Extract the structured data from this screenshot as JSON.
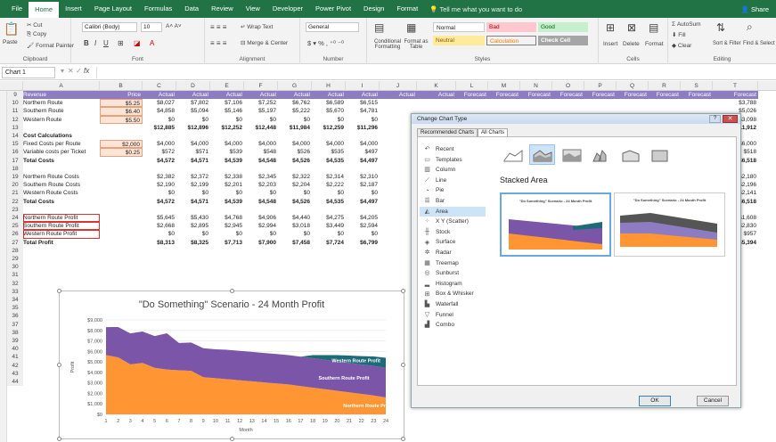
{
  "ribbon_tabs": [
    "File",
    "Home",
    "Insert",
    "Page Layout",
    "Formulas",
    "Data",
    "Review",
    "View",
    "Developer",
    "Power Pivot",
    "Design",
    "Format"
  ],
  "active_tab": "Home",
  "tell_me": "Tell me what you want to do",
  "share": "Share",
  "clipboard": {
    "paste": "Paste",
    "cut": "Cut",
    "copy": "Copy",
    "format_painter": "Format Painter",
    "label": "Clipboard"
  },
  "font": {
    "name": "Calibri (Body)",
    "size": "10",
    "label": "Font"
  },
  "alignment": {
    "wrap": "Wrap Text",
    "merge": "Merge & Center",
    "label": "Alignment"
  },
  "number": {
    "format": "General",
    "label": "Number"
  },
  "styles": {
    "cond": "Conditional Formatting",
    "table": "Format as Table",
    "normal": "Normal",
    "bad": "Bad",
    "good": "Good",
    "neutral": "Neutral",
    "calculation": "Calculation",
    "check": "Check Cell",
    "label": "Styles"
  },
  "cells": {
    "insert": "Insert",
    "delete": "Delete",
    "format": "Format",
    "label": "Cells"
  },
  "editing": {
    "autosum": "AutoSum",
    "fill": "Fill",
    "clear": "Clear",
    "sort": "Sort & Filter",
    "find": "Find & Select",
    "label": "Editing"
  },
  "namebox": "Chart 1",
  "fx": "fx",
  "columns": [
    "A",
    "B",
    "C",
    "D",
    "E",
    "F",
    "G",
    "H",
    "I",
    "J",
    "K",
    "L",
    "M",
    "N",
    "O",
    "P",
    "Q",
    "R",
    "S",
    "T"
  ],
  "header_row": {
    "num": "9",
    "a": "Revenue",
    "b": "Price",
    "cols": [
      "Actual",
      "Actual",
      "Actual",
      "Actual",
      "Actual",
      "Actual",
      "Actual",
      "Actual",
      "Actual"
    ],
    "forecast": [
      "Forecast",
      "Forecast",
      "Forecast",
      "Forecast",
      "Forecast",
      "Forecast",
      "Forecast",
      "Forecast",
      "Forecast",
      "Forecast"
    ]
  },
  "rows": [
    {
      "num": "10",
      "a": "Northern Route",
      "b": "$5.25",
      "vals": [
        "$8,027",
        "$7,802",
        "$7,106",
        "$7,252",
        "$6,762",
        "$6,589",
        "$6,515"
      ],
      "right": "$3,788"
    },
    {
      "num": "11",
      "a": "Southern Route",
      "b": "$6.40",
      "vals": [
        "$4,858",
        "$5,094",
        "$5,146",
        "$5,197",
        "$5,222",
        "$5,670",
        "$4,781"
      ],
      "right": "$5,026"
    },
    {
      "num": "12",
      "a": "Western Route",
      "b": "$5.50",
      "vals": [
        "$0",
        "$0",
        "$0",
        "$0",
        "$0",
        "$0",
        "$0"
      ],
      "right": "$3,098"
    },
    {
      "num": "13",
      "a": "",
      "b": "",
      "vals": [
        "$12,885",
        "$12,896",
        "$12,252",
        "$12,448",
        "$11,984",
        "$12,259",
        "$11,296"
      ],
      "right": "$11,912",
      "bold": true
    },
    {
      "num": "14",
      "a": "Cost Calculations",
      "b": "",
      "vals": [],
      "right": "",
      "bold": true
    },
    {
      "num": "15",
      "a": "Fixed Costs per Route",
      "b": "$2,000",
      "vals": [
        "$4,000",
        "$4,000",
        "$4,000",
        "$4,000",
        "$4,000",
        "$4,000",
        "$4,000"
      ],
      "right": "$6,000"
    },
    {
      "num": "16",
      "a": "Variable costs per Ticket",
      "b": "$0.25",
      "vals": [
        "$572",
        "$571",
        "$539",
        "$548",
        "$526",
        "$535",
        "$497"
      ],
      "right": "$518"
    },
    {
      "num": "17",
      "a": "Total Costs",
      "b": "",
      "vals": [
        "$4,572",
        "$4,571",
        "$4,539",
        "$4,548",
        "$4,526",
        "$4,535",
        "$4,497"
      ],
      "right": "$6,518",
      "bold": true
    },
    {
      "num": "18",
      "a": "",
      "b": "",
      "vals": [],
      "right": ""
    },
    {
      "num": "19",
      "a": "Northern Route Costs",
      "b": "",
      "vals": [
        "$2,382",
        "$2,372",
        "$2,338",
        "$2,345",
        "$2,322",
        "$2,314",
        "$2,310"
      ],
      "right": "$2,180"
    },
    {
      "num": "20",
      "a": "Southern Route Costs",
      "b": "",
      "vals": [
        "$2,190",
        "$2,199",
        "$2,201",
        "$2,203",
        "$2,204",
        "$2,222",
        "$2,187"
      ],
      "right": "$2,196"
    },
    {
      "num": "21",
      "a": "Western Route Costs",
      "b": "",
      "vals": [
        "$0",
        "$0",
        "$0",
        "$0",
        "$0",
        "$0",
        "$0"
      ],
      "right": "$2,141"
    },
    {
      "num": "22",
      "a": "Total Costs",
      "b": "",
      "vals": [
        "$4,572",
        "$4,571",
        "$4,539",
        "$4,548",
        "$4,526",
        "$4,535",
        "$4,497"
      ],
      "right": "$6,518",
      "bold": true
    },
    {
      "num": "23",
      "a": "",
      "b": "",
      "vals": [],
      "right": ""
    },
    {
      "num": "24",
      "a": "Northern Route Profit",
      "b": "",
      "vals": [
        "$5,645",
        "$5,430",
        "$4,768",
        "$4,906",
        "$4,440",
        "$4,275",
        "$4,205"
      ],
      "right": "$1,608"
    },
    {
      "num": "25",
      "a": "Southern Route Profit",
      "b": "",
      "vals": [
        "$2,668",
        "$2,895",
        "$2,945",
        "$2,994",
        "$3,018",
        "$3,449",
        "$2,594"
      ],
      "right": "$2,830"
    },
    {
      "num": "26",
      "a": "Western Route Profit",
      "b": "",
      "vals": [
        "$0",
        "$0",
        "$0",
        "$0",
        "$0",
        "$0",
        "$0"
      ],
      "right": "$957"
    },
    {
      "num": "27",
      "a": "Total Profit",
      "b": "",
      "vals": [
        "$8,313",
        "$8,325",
        "$7,713",
        "$7,900",
        "$7,458",
        "$7,724",
        "$6,799"
      ],
      "right": "$5,394",
      "bold": true
    }
  ],
  "empty_rows": [
    "28",
    "29",
    "30",
    "31",
    "32",
    "33",
    "34",
    "35",
    "36",
    "37",
    "38",
    "39",
    "40",
    "41",
    "42",
    "43",
    "44"
  ],
  "dialog": {
    "title": "Change Chart Type",
    "tabs": [
      "Recommended Charts",
      "All Charts"
    ],
    "types": [
      {
        "label": "Recent",
        "icon": "recent-icon",
        "glyph": "↶"
      },
      {
        "label": "Templates",
        "icon": "templates-icon",
        "glyph": "▭"
      },
      {
        "label": "Column",
        "icon": "column-chart-icon",
        "glyph": "▥"
      },
      {
        "label": "Line",
        "icon": "line-chart-icon",
        "glyph": "⟋"
      },
      {
        "label": "Pie",
        "icon": "pie-chart-icon",
        "glyph": "◔"
      },
      {
        "label": "Bar",
        "icon": "bar-chart-icon",
        "glyph": "☰"
      },
      {
        "label": "Area",
        "icon": "area-chart-icon",
        "glyph": "◭"
      },
      {
        "label": "X Y (Scatter)",
        "icon": "scatter-chart-icon",
        "glyph": "⁘"
      },
      {
        "label": "Stock",
        "icon": "stock-chart-icon",
        "glyph": "╫"
      },
      {
        "label": "Surface",
        "icon": "surface-chart-icon",
        "glyph": "◈"
      },
      {
        "label": "Radar",
        "icon": "radar-chart-icon",
        "glyph": "✲"
      },
      {
        "label": "Treemap",
        "icon": "treemap-icon",
        "glyph": "▦"
      },
      {
        "label": "Sunburst",
        "icon": "sunburst-icon",
        "glyph": "◎"
      },
      {
        "label": "Histogram",
        "icon": "histogram-icon",
        "glyph": "▂"
      },
      {
        "label": "Box & Whisker",
        "icon": "box-whisker-icon",
        "glyph": "⊞"
      },
      {
        "label": "Waterfall",
        "icon": "waterfall-icon",
        "glyph": "▙"
      },
      {
        "label": "Funnel",
        "icon": "funnel-icon",
        "glyph": "▽"
      },
      {
        "label": "Combo",
        "icon": "combo-chart-icon",
        "glyph": "▟"
      }
    ],
    "selected_type": "Area",
    "subtype_title": "Stacked Area",
    "preview_title": "\"Do Something\" Scenario - 24 Month Profit",
    "ok": "OK",
    "cancel": "Cancel"
  },
  "chart_data": {
    "type": "area",
    "title": "\"Do Something\" Scenario - 24 Month Profit",
    "xlabel": "Month",
    "ylabel": "Profit",
    "x": [
      1,
      2,
      3,
      4,
      5,
      6,
      7,
      8,
      9,
      10,
      11,
      12,
      13,
      14,
      15,
      16,
      17,
      18,
      19,
      20,
      21,
      22,
      23,
      24
    ],
    "yticks": [
      "$0",
      "$1,000",
      "$2,000",
      "$3,000",
      "$4,000",
      "$5,000",
      "$6,000",
      "$7,000",
      "$8,000",
      "$9,000"
    ],
    "ylim": [
      0,
      9000
    ],
    "stacked": true,
    "series": [
      {
        "name": "Northern Route Profit",
        "color": "#ff9533",
        "values": [
          5645,
          5430,
          4768,
          4906,
          4440,
          4275,
          4205,
          4150,
          3550,
          3450,
          3350,
          3250,
          3150,
          3050,
          2950,
          2850,
          2700,
          2550,
          2400,
          2250,
          2100,
          1950,
          1800,
          1608
        ]
      },
      {
        "name": "Southern Route Profit",
        "color": "#7a55a8",
        "values": [
          2668,
          2895,
          2945,
          2994,
          3018,
          3449,
          2594,
          2700,
          2750,
          2750,
          2800,
          2800,
          2800,
          2800,
          2800,
          2800,
          2800,
          2800,
          2800,
          2800,
          2800,
          2800,
          2820,
          2830
        ]
      },
      {
        "name": "Western Route Profit",
        "color": "#1e6b78",
        "values": [
          0,
          0,
          0,
          0,
          0,
          0,
          0,
          0,
          0,
          0,
          0,
          0,
          0,
          0,
          0,
          0,
          0,
          300,
          450,
          600,
          700,
          800,
          900,
          957
        ]
      }
    ]
  }
}
